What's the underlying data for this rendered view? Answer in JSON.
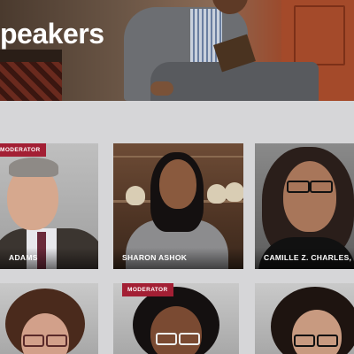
{
  "hero": {
    "title": "peakers"
  },
  "speakers": [
    {
      "name": "ADAMS",
      "badge": "MODERATOR"
    },
    {
      "name": "SHARON ASHOK",
      "badge": ""
    },
    {
      "name": "CAMILLE Z. CHARLES, P",
      "badge": ""
    },
    {
      "name": "",
      "badge": ""
    },
    {
      "name": "",
      "badge": "MODERATOR"
    },
    {
      "name": "",
      "badge": ""
    }
  ],
  "colors": {
    "badge": "#a31f34",
    "page_background": "#d6d6d8"
  }
}
